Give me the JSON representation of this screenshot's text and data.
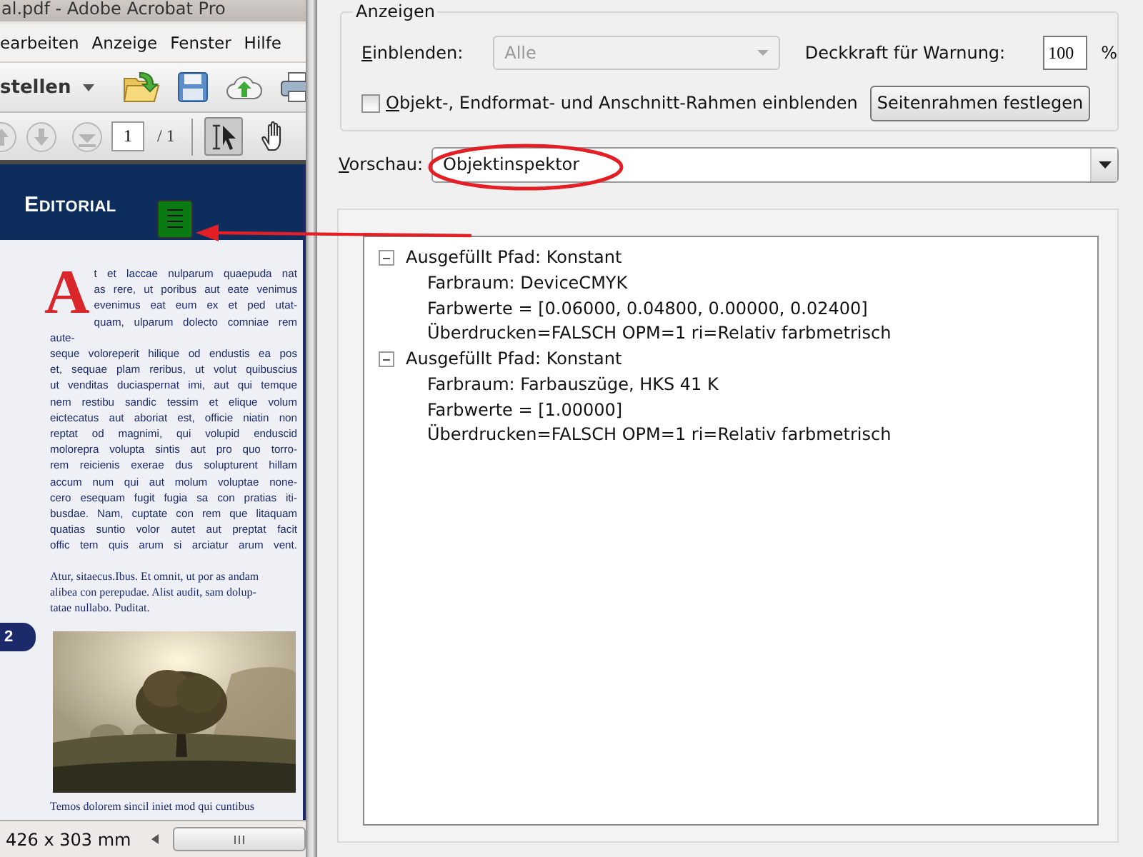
{
  "acrobat_window": {
    "title": "al.pdf - Adobe Acrobat Pro",
    "menu": [
      "earbeiten",
      "Anzeige",
      "Fenster",
      "Hilfe"
    ],
    "create_button": "stellen",
    "nav": {
      "page": "1",
      "page_total": "/ 1",
      "tools": [
        {
          "kind": "select",
          "selected": true
        },
        {
          "kind": "hand",
          "selected": false
        }
      ]
    },
    "document": {
      "header": "EDITORIAL",
      "body": "At et laccae nulparum quaepuda nat\nas rere, ut poribus aut eate venimus\nevenimus eat eum ex et ped utat-\nquam, ulparum dolecto comniae rem aute-\nseque voloreperit hilique od endustis ea pos\net, sequae plam reribus, ut volut quibuscius\nut venditas duciaspernat imi, aut qui temque\nnem restibu sandic tessim et elique volum\neictecatus aut aboriat est, officie niatin non\nreptat od magnimi, qui volupid enduscid\nmolorepra volupta sintis aut pro quo torro-\nrem reicienis exerae dus solupturent hillam\naccum num qui aut molum voluptae none-\ncero esequam fugit fugia sa con pratias iti-\nbusdae. Nam, cuptate con rem que litaquam\nquatias suntio volor autet aut preptat facit\noffic tem quis arum si arciatur arum vent.",
      "serif_paragraph": "Atur, sitaecus.Ibus. Et omnit, ut por as andam\nalibea con perepudae. Alist audit, sam dolup-\ntatae nullabo. Puditat.",
      "page_tab": "2",
      "cut_line": "Temos dolorem sincil iniet mod qui cuntibus"
    },
    "status_bar": {
      "dimensions": "426 x 303 mm"
    }
  },
  "output_preview": {
    "group_title": "Anzeigen",
    "show_label": "Einblenden:",
    "show_value": "Alle",
    "show_disabled": true,
    "opacity_label": "Deckkraft für Warnung:",
    "opacity_value": "100",
    "percent": "%",
    "frames_checkbox": {
      "label": "Objekt-, Endformat- und Anschnitt-Rahmen einblenden",
      "checked": false
    },
    "page_frames_button": "Seitenrahmen festlegen",
    "preview_label": "Vorschau:",
    "preview_value": "Objektinspektor",
    "tree": [
      {
        "label": "Ausgefüllt Pfad: Konstant",
        "expanded": true,
        "children": [
          {
            "label": "Farbraum: DeviceCMYK"
          },
          {
            "label": "Farbwerte = [0.06000, 0.04800, 0.00000, 0.02400]"
          },
          {
            "label": "Überdrucken=FALSCH OPM=1 ri=Relativ farbmetrisch"
          }
        ]
      },
      {
        "label": "Ausgefüllt Pfad: Konstant",
        "expanded": true,
        "children": [
          {
            "label": "Farbraum: Farbauszüge, HKS 41 K"
          },
          {
            "label": "Farbwerte = [1.00000]"
          },
          {
            "label": "Überdrucken=FALSCH OPM=1 ri=Relativ farbmetrisch"
          }
        ]
      }
    ]
  }
}
